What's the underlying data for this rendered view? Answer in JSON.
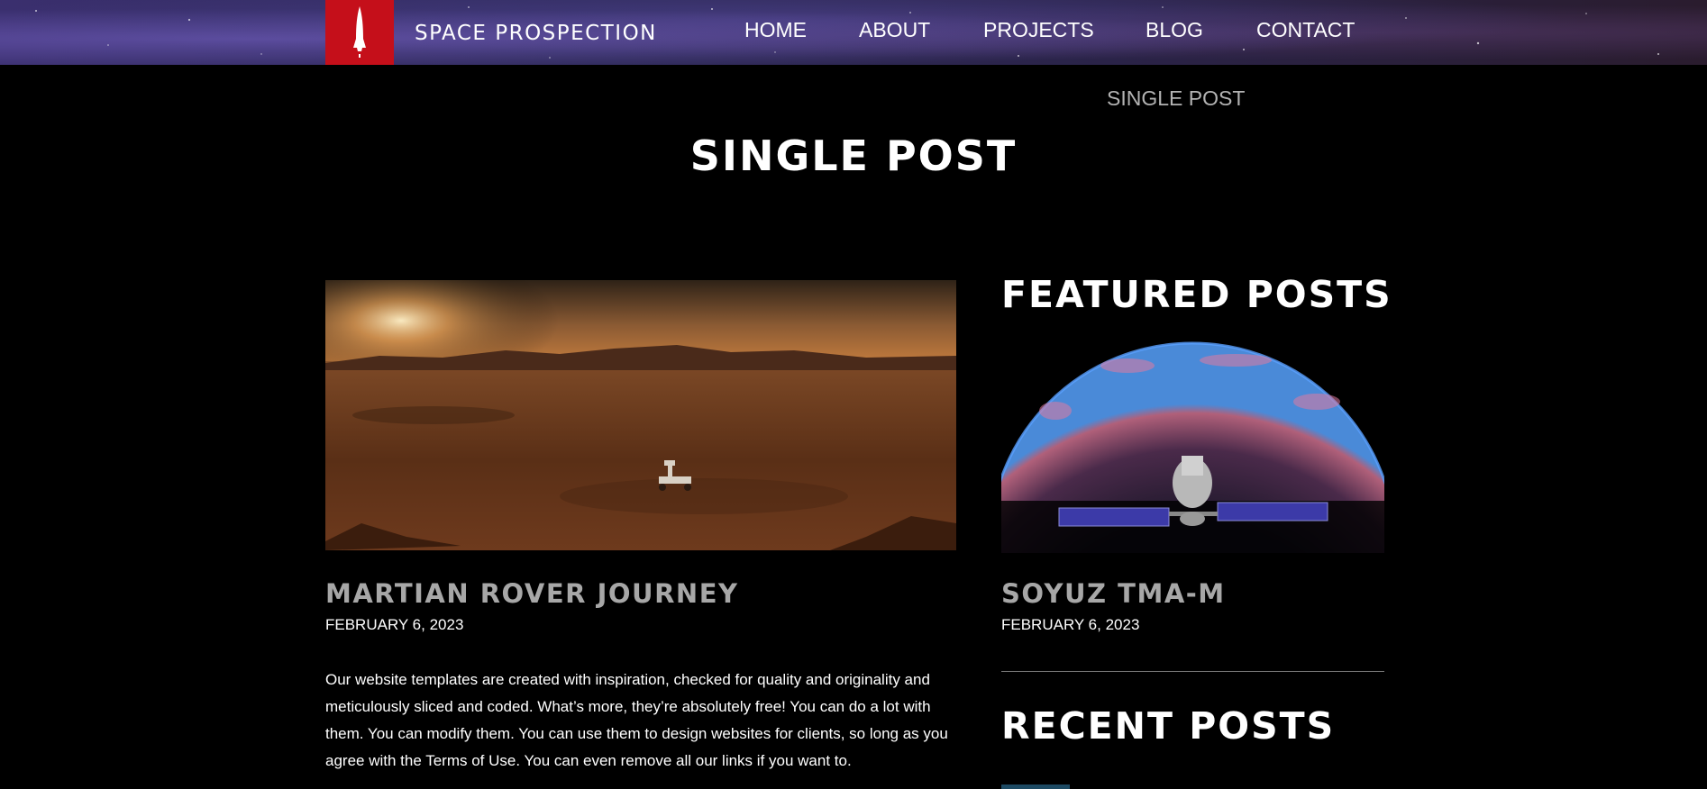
{
  "header": {
    "site_name": "SPACE PROSPECTION",
    "logo_icon": "rocket-icon",
    "nav": [
      {
        "label": "HOME"
      },
      {
        "label": "ABOUT"
      },
      {
        "label": "PROJECTS"
      },
      {
        "label": "BLOG"
      },
      {
        "label": "CONTACT"
      }
    ]
  },
  "breadcrumb": "SINGLE POST",
  "page_title": "SINGLE POST",
  "post": {
    "title": "MARTIAN ROVER JOURNEY",
    "date": "FEBRUARY 6, 2023",
    "body": "Our website templates are created with inspiration, checked for quality and originality and meticulously sliced and coded. What’s more, they’re absolutely free! You can do a lot with them. You can modify them. You can use them to design websites for clients, so long as you agree with the Terms of Use. You can even remove all our links if you want to."
  },
  "sidebar": {
    "featured_heading": "FEATURED POSTS",
    "featured": {
      "title": "SOYUZ TMA-M",
      "date": "FEBRUARY 6, 2023"
    },
    "recent_heading": "RECENT POSTS"
  },
  "colors": {
    "accent": "#c50f1a",
    "background": "#000000",
    "muted_title": "#a7a7a7"
  }
}
